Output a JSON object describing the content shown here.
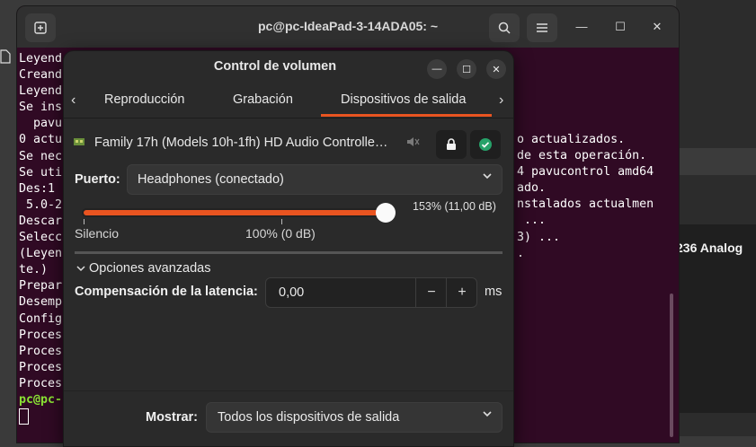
{
  "terminal": {
    "title": "pc@pc-IdeaPad-3-14ADA05: ~",
    "lines": [
      "Leyend",
      "Creand",
      "Leyend",
      "Se ins",
      "  pavu",
      "0 actu",
      "Se nec",
      "Se uti",
      "Des:1",
      " 5.0-2",
      "Descar",
      "Selecc",
      "(Leyen",
      "te.)",
      "Prepar",
      "Desemp",
      "Config",
      "Proces",
      "Proces",
      "Proces",
      "Proces"
    ],
    "prompt": "pc@pc-",
    "right_lines": [
      "o actualizados.",
      "",
      "de esta operación.",
      "4 pavucontrol amd64",
      "",
      "",
      "ado.",
      "nstalados actualmen",
      "",
      " ...",
      "",
      "",
      "",
      "",
      "3) ...",
      "."
    ]
  },
  "background_app": {
    "label": "236 Analog"
  },
  "dialog": {
    "title": "Control de volumen",
    "tabs": [
      "Reproducción",
      "Grabación",
      "Dispositivos de salida"
    ],
    "active_tab": "Dispositivos de salida",
    "device_name": "Family 17h (Models 10h-1fh) HD Audio Controlle…",
    "port_label": "Puerto:",
    "port_value": "Headphones (conectado)",
    "volume_percent_label": "153% (11,00 dB)",
    "volume_level": 1.53,
    "label_silence": "Silencio",
    "label_100": "100% (0 dB)",
    "advanced_label": "Opciones avanzadas",
    "latency_label": "Compensación de la latencia:",
    "latency_value": "0,00",
    "latency_unit": "ms",
    "show_label": "Mostrar:",
    "show_value": "Todos los dispositivos de salida"
  },
  "colors": {
    "accent": "#e95420",
    "terminal_bg": "#300a24",
    "prompt_green": "#8ae234",
    "check_green": "#26a269"
  }
}
